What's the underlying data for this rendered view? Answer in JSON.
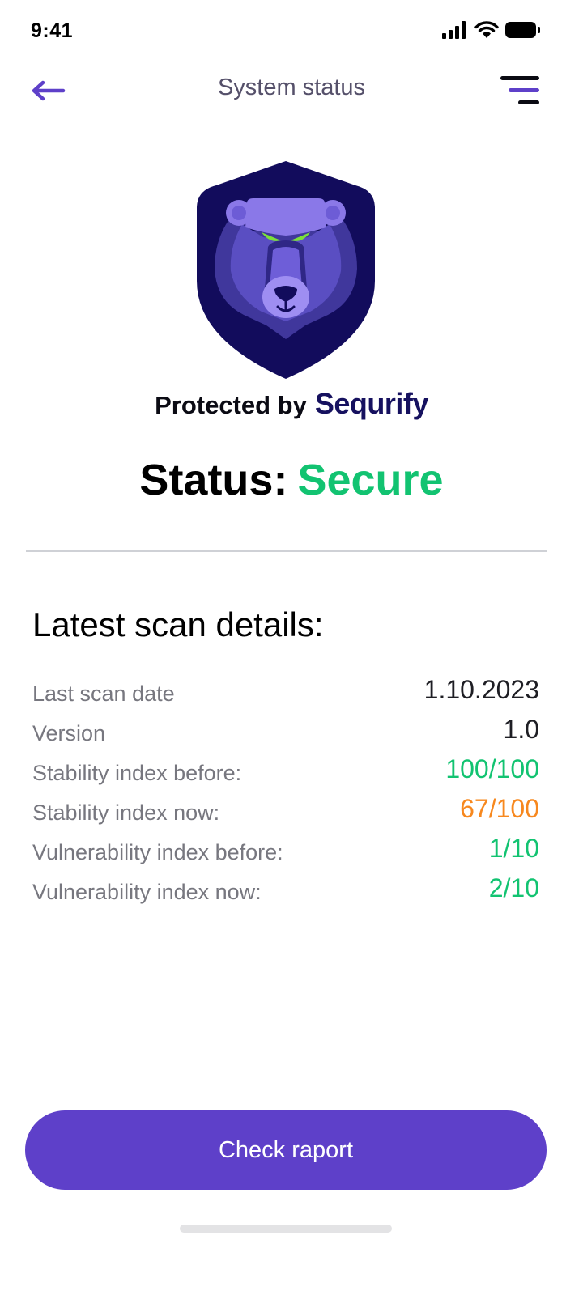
{
  "status_bar": {
    "time": "9:41"
  },
  "nav": {
    "title": "System status"
  },
  "brand": {
    "protected_prefix": "Protected by",
    "name": "Sequrify"
  },
  "status": {
    "label": "Status:",
    "value": "Secure"
  },
  "scan": {
    "title": "Latest scan details:",
    "rows": [
      {
        "label": "Last scan date",
        "value": "1.10.2023"
      },
      {
        "label": "Version",
        "value": "1.0"
      },
      {
        "label": "Stability index before:",
        "value": "100/100"
      },
      {
        "label": "Stability index now:",
        "value": "67/100"
      },
      {
        "label": "Vulnerability index before:",
        "value": "1/10"
      },
      {
        "label": "Vulnerability index now:",
        "value": "2/10"
      }
    ]
  },
  "cta": {
    "label": "Check raport"
  },
  "colors": {
    "accent": "#5e40c9",
    "secure_green": "#12c371",
    "warning_orange": "#f7881e",
    "brand_navy": "#16115f"
  },
  "icons": [
    "signal-icon",
    "wifi-icon",
    "battery-icon",
    "back-arrow-icon",
    "menu-icon",
    "bear-shield-logo"
  ]
}
